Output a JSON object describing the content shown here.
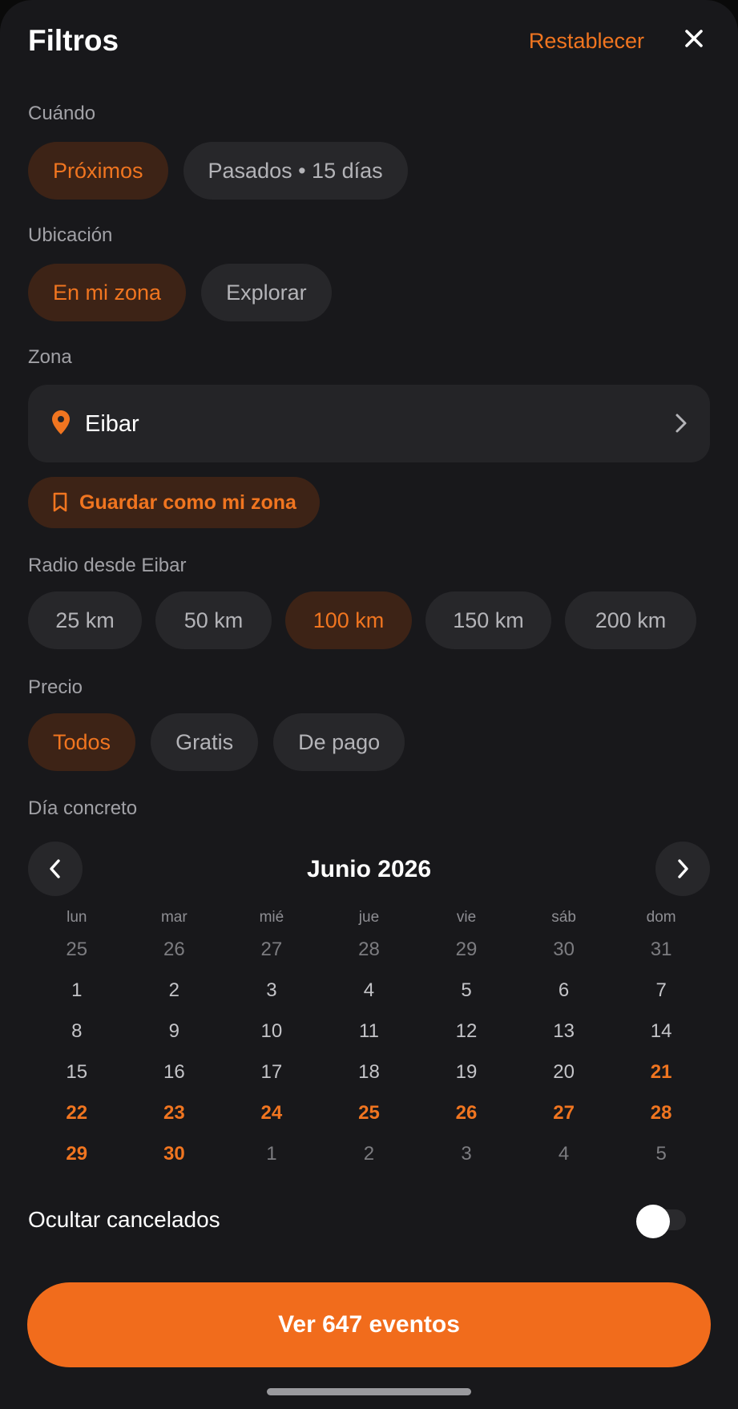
{
  "header": {
    "title": "Filtros",
    "reset_label": "Restablecer",
    "close_icon": "close-icon"
  },
  "when": {
    "label": "Cuándo",
    "options": [
      "Próximos",
      "Pasados • 15 días"
    ],
    "selected": "Próximos"
  },
  "location": {
    "label": "Ubicación",
    "options": [
      "En mi zona",
      "Explorar"
    ],
    "selected": "En mi zona"
  },
  "zone": {
    "label": "Zona",
    "value": "Eibar",
    "icon": "location-pin-icon",
    "save_label": "Guardar como mi zona",
    "save_icon": "bookmark-icon"
  },
  "radius": {
    "label": "Radio desde Eibar",
    "options": [
      "25 km",
      "50 km",
      "100 km",
      "150 km",
      "200 km"
    ],
    "selected": "100 km"
  },
  "price": {
    "label": "Precio",
    "options": [
      "Todos",
      "Gratis",
      "De pago"
    ],
    "selected": "Todos"
  },
  "calendar": {
    "label": "Día concreto",
    "month_title": "Junio 2026",
    "weekdays": [
      "lun",
      "mar",
      "mié",
      "jue",
      "vie",
      "sáb",
      "dom"
    ],
    "weeks": [
      [
        "25",
        "26",
        "27",
        "28",
        "29",
        "30",
        "31"
      ],
      [
        "1",
        "2",
        "3",
        "4",
        "5",
        "6",
        "7"
      ],
      [
        "8",
        "9",
        "10",
        "11",
        "12",
        "13",
        "14"
      ],
      [
        "15",
        "16",
        "17",
        "18",
        "19",
        "20",
        "21"
      ],
      [
        "22",
        "23",
        "24",
        "25",
        "26",
        "27",
        "28"
      ],
      [
        "29",
        "30",
        "1",
        "2",
        "3",
        "4",
        "5"
      ]
    ],
    "highlighted_days": [
      "21",
      "22",
      "23",
      "24",
      "25",
      "26",
      "27",
      "28",
      "29",
      "30"
    ]
  },
  "hide_cancelled": {
    "label": "Ocultar cancelados",
    "enabled": false
  },
  "cta": {
    "label": "Ver 647 eventos"
  },
  "colors": {
    "accent": "#f07520",
    "background": "#18181b",
    "chip": "#27272a",
    "chip_active": "#3d2316",
    "cta": "#f16c1c"
  }
}
